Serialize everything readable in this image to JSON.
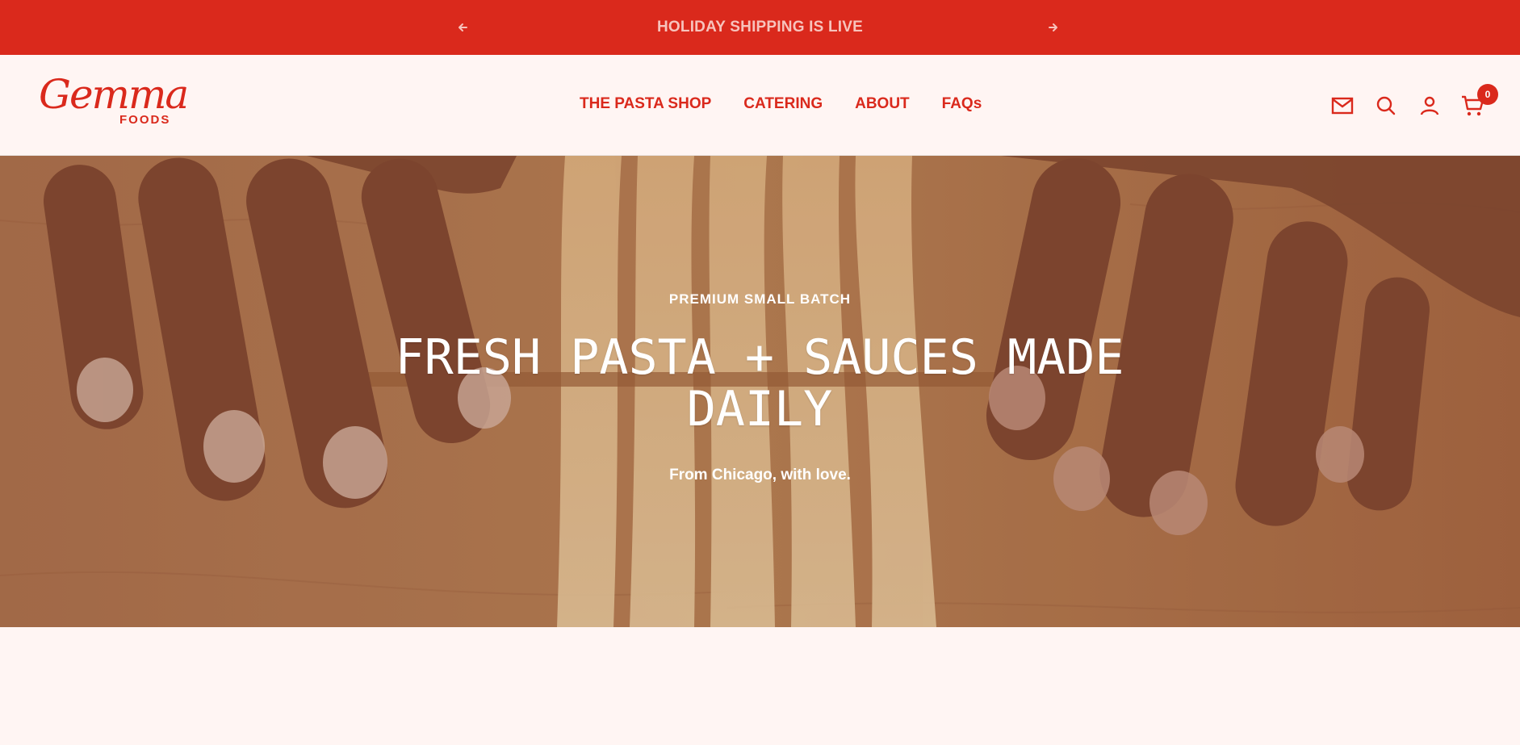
{
  "announcement": {
    "text": "HOLIDAY SHIPPING IS LIVE",
    "prev_icon": "arrow-left-icon",
    "next_icon": "arrow-right-icon"
  },
  "brand": {
    "logo_script": "Gemma",
    "logo_sub": "FOODS",
    "color": "#da291c"
  },
  "nav": {
    "items": [
      {
        "label": "THE PASTA SHOP"
      },
      {
        "label": "CATERING"
      },
      {
        "label": "ABOUT"
      },
      {
        "label": "FAQs"
      }
    ]
  },
  "header_icons": {
    "newsletter": "mail-icon",
    "search": "search-icon",
    "account": "user-icon",
    "cart": "cart-icon",
    "cart_count": "0"
  },
  "hero": {
    "eyebrow": "PREMIUM SMALL BATCH",
    "headline": "FRESH PASTA + SAUCES MADE DAILY",
    "subheadline": "From Chicago, with love."
  },
  "colors": {
    "accent": "#da291c",
    "background": "#fff5f3",
    "announcement_text": "#f7c3bc"
  }
}
